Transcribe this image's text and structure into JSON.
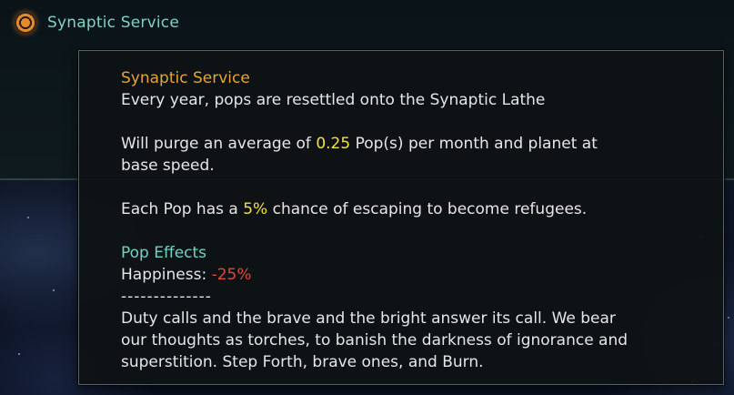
{
  "tradition": {
    "title": "Synaptic Service",
    "icon": "tradition-ring-icon"
  },
  "tooltip": {
    "title": "Synaptic Service",
    "description": "Every year, pops are resettled onto the Synaptic Lathe",
    "purge": {
      "prefix": "Will purge an average of ",
      "value": "0.25",
      "suffix": " Pop(s) per month and planet at",
      "line2": "base speed."
    },
    "escape": {
      "prefix": "Each Pop has a ",
      "value": "5%",
      "suffix": " chance of escaping to become refugees."
    },
    "pop_effects": {
      "heading": "Pop Effects",
      "happiness_label": "Happiness: ",
      "happiness_value": "-25%"
    },
    "separator": "--------------",
    "flavor": [
      "Duty calls and the brave and the bright answer its call. We bear",
      "our thoughts as torches, to banish the darkness of ignorance and",
      "superstition. Step Forth, brave ones, and Burn."
    ]
  },
  "colors": {
    "title_orange": "#e8a23a",
    "header_teal": "#7fd2c4",
    "highlight_yellow": "#f2e33a",
    "negative_red": "#e2473a"
  }
}
